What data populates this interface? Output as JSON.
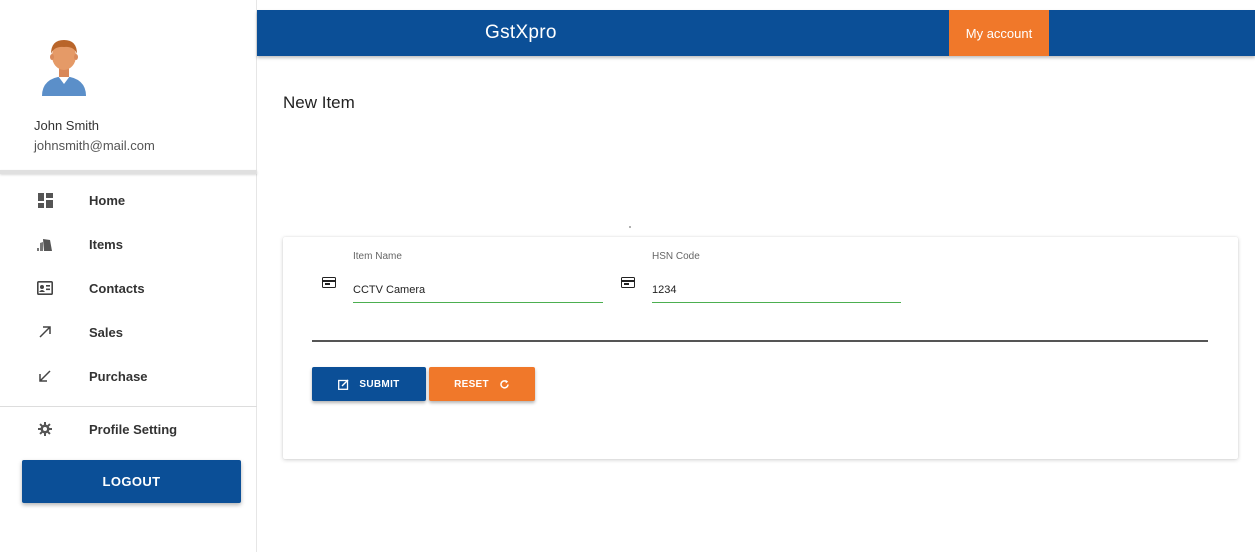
{
  "user": {
    "name": "John Smith",
    "email": "johnsmith@mail.com"
  },
  "sidebar": {
    "items": [
      {
        "label": "Home",
        "icon": "dashboard-icon"
      },
      {
        "label": "Items",
        "icon": "items-icon"
      },
      {
        "label": "Contacts",
        "icon": "contact-card-icon"
      },
      {
        "label": "Sales",
        "icon": "arrow-up-right-icon"
      },
      {
        "label": "Purchase",
        "icon": "arrow-down-left-icon"
      }
    ],
    "profile_setting": {
      "label": "Profile Setting",
      "icon": "gear-icon"
    },
    "logout_label": "LOGOUT"
  },
  "header": {
    "title": "GstXpro",
    "account_label": "My account"
  },
  "page": {
    "title": "New Item"
  },
  "form": {
    "item_name": {
      "label": "Item Name",
      "value": "CCTV Camera",
      "icon": "input-field-icon"
    },
    "hsn_code": {
      "label": "HSN Code",
      "value": "1234",
      "icon": "input-field-icon"
    },
    "submit_label": "SUBMIT",
    "reset_label": "RESET"
  },
  "colors": {
    "primary": "#0b4f97",
    "accent": "#f0782a",
    "input_underline": "#4caf50"
  }
}
